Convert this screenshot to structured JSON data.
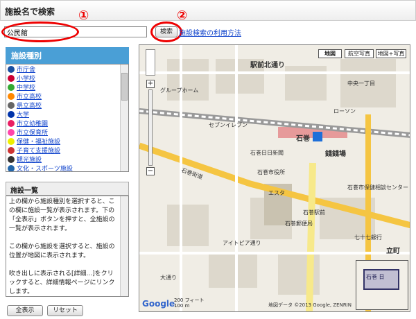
{
  "header": {
    "title": "施設名で検索"
  },
  "search": {
    "value": "公民館",
    "button": "検索",
    "help_link": "施設検索の利用方法"
  },
  "annotations": {
    "one": "①",
    "two": "②"
  },
  "category_panel": {
    "title": "施設種別",
    "items": [
      {
        "label": "市庁舎",
        "color": "#1a4fa0"
      },
      {
        "label": "小学校",
        "color": "#c03"
      },
      {
        "label": "中学校",
        "color": "#3a3"
      },
      {
        "label": "市立高校",
        "color": "#f80"
      },
      {
        "label": "県立高校",
        "color": "#666"
      },
      {
        "label": "大学",
        "color": "#03a"
      },
      {
        "label": "市立幼稚園",
        "color": "#e91e63"
      },
      {
        "label": "市立保育所",
        "color": "#f4a"
      },
      {
        "label": "保健・福祉施設",
        "color": "#ee0"
      },
      {
        "label": "子育て支援施設",
        "color": "#c33"
      },
      {
        "label": "観光施設",
        "color": "#333"
      },
      {
        "label": "文化・スポーツ施設",
        "color": "#26a"
      }
    ]
  },
  "facility_panel": {
    "title": "施設一覧",
    "paragraphs": [
      "上の欄から施設種別を選択すると、この欄に施設一覧が表示されます。下の「全表示」ボタンを押すと、全施設の一覧が表示されます。",
      "この欄から施設を選択すると、施設の位置が地図に表示されます。",
      "吹き出しに表示される[詳細...]をクリックすると、詳細情報ページにリンクします。"
    ]
  },
  "buttons": {
    "show_all": "全表示",
    "reset": "リセット"
  },
  "map": {
    "types": [
      "地図",
      "航空写真",
      "地図+写真"
    ],
    "labels": [
      "駅前北通り",
      "中央一丁目",
      "石巻駅",
      "錢錢場",
      "石巻市役所",
      "エスタ",
      "石巻郵便局",
      "立町",
      "七十七銀行",
      "アイトピア通り",
      "石巻街道",
      "セブンイレブン",
      "ローソン",
      "グループホーム",
      "石巻市保健相談センター",
      "石巻日日新聞",
      "石巻駅前",
      "大通り"
    ],
    "station": "石巻",
    "minimap_label": "石巻 日",
    "scale": [
      "200 フィート",
      "100 m"
    ],
    "copyright": "地図データ ©2013 Google, ZENRIN",
    "google": "Google"
  }
}
